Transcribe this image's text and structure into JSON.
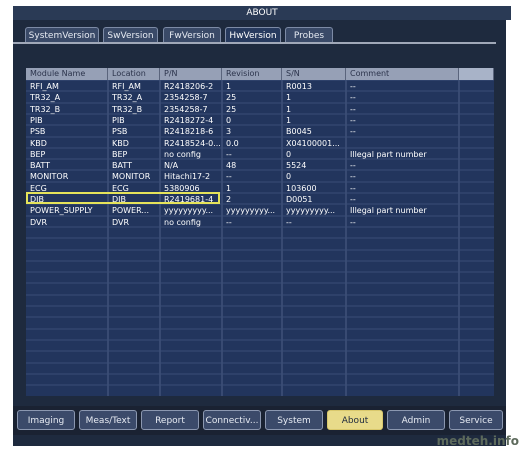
{
  "title": "ABOUT",
  "tabs": [
    {
      "label": "SystemVersion",
      "active": false
    },
    {
      "label": "SwVersion",
      "active": false
    },
    {
      "label": "FwVersion",
      "active": false
    },
    {
      "label": "HwVersion",
      "active": true
    },
    {
      "label": "Probes",
      "active": false
    }
  ],
  "table": {
    "columns": [
      "Module Name",
      "Location",
      "P/N",
      "Revision",
      "S/N",
      "Comment"
    ],
    "rows": [
      [
        "RFI_AM",
        "RFI_AM",
        "R2418206-2",
        "1",
        "R0013",
        "--"
      ],
      [
        "TR32_A",
        "TR32_A",
        "2354258-7",
        "25",
        "1",
        "--"
      ],
      [
        "TR32_B",
        "TR32_B",
        "2354258-7",
        "25",
        "1",
        "--"
      ],
      [
        "PIB",
        "PIB",
        "R2418272-4",
        "0",
        "1",
        "--"
      ],
      [
        "PSB",
        "PSB",
        "R2418218-6",
        "3",
        "B0045",
        "--"
      ],
      [
        "KBD",
        "KBD",
        "R2418524-0...",
        "0.0",
        "X04100001...",
        ""
      ],
      [
        "BEP",
        "BEP",
        "no config",
        "--",
        "0",
        "Illegal part number"
      ],
      [
        "BATT",
        "BATT",
        "N/A",
        "48",
        "5524",
        "--"
      ],
      [
        "MONITOR",
        "MONITOR",
        "Hitachi17-2",
        "--",
        "0",
        "--"
      ],
      [
        "ECG",
        "ECG",
        "5380906",
        "1",
        "103600",
        "--"
      ],
      [
        "DIB",
        "DIB",
        "R2419681-4",
        "2",
        "D0051",
        "--"
      ],
      [
        "POWER_SUPPLY",
        "POWER...",
        "yyyyyyyyy...",
        "yyyyyyyyy...",
        "yyyyyyyyy...",
        "Illegal part number"
      ],
      [
        "DVR",
        "DVR",
        "no config",
        "--",
        "--",
        "--"
      ]
    ],
    "highlighted_row": 9
  },
  "bottom_buttons": [
    {
      "label": "Imaging",
      "active": false
    },
    {
      "label": "Meas/Text",
      "active": false
    },
    {
      "label": "Report",
      "active": false
    },
    {
      "label": "Connectiv...",
      "active": false
    },
    {
      "label": "System",
      "active": false
    },
    {
      "label": "About",
      "active": true
    },
    {
      "label": "Admin",
      "active": false
    },
    {
      "label": "Service",
      "active": false
    }
  ],
  "watermark": "medteh.info",
  "colors": {
    "panel": "#1e2a3e",
    "table_bg": "#22355d",
    "header_bg": "#96a0b6",
    "highlight": "#e5e35a",
    "active_button": "#e8db8a"
  }
}
